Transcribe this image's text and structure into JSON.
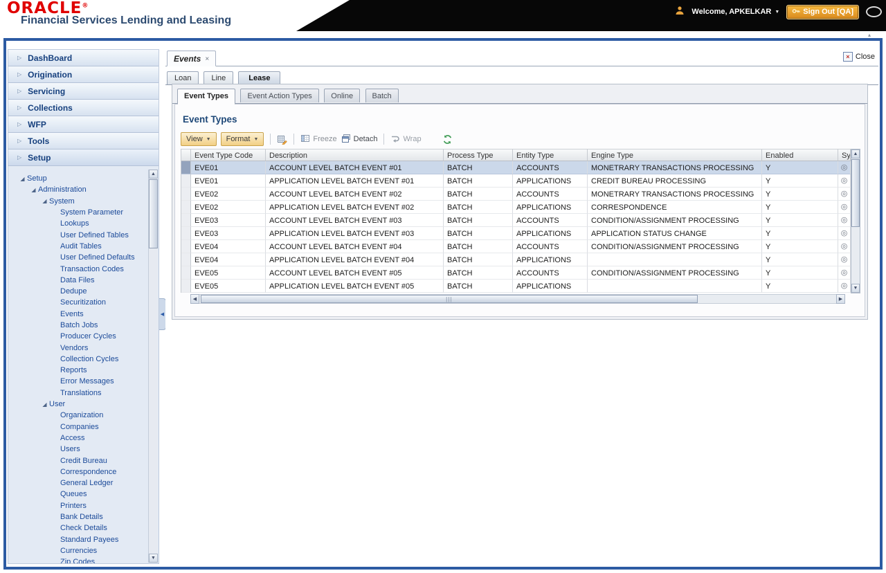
{
  "header": {
    "logo": "ORACLE",
    "registered_mark": "®",
    "subtitle": "Financial Services Lending and Leasing",
    "welcome_label": "Welcome, APKELKAR",
    "sign_out_label": "Sign Out [QA]"
  },
  "colors": {
    "oracle_red": "#e00000",
    "subtitle_blue": "#2c4a70",
    "frame_blue": "#2d5ba3",
    "toolbar_amber": "#f2cf85",
    "selected_row": "#cbd8ea"
  },
  "icons": {
    "accordion_arrow": "▷",
    "caret_down": "▼",
    "close_x": "×",
    "radio": "◎",
    "scroll_up": "▲",
    "scroll_down": "▼",
    "scroll_left": "◀",
    "scroll_right": "▶",
    "collapse_left": "◀",
    "grip": "|||",
    "mini_collapse": "▴"
  },
  "sidebar": {
    "accordion": [
      {
        "label": "DashBoard",
        "cls": ""
      },
      {
        "label": "Origination",
        "cls": ""
      },
      {
        "label": "Servicing",
        "cls": ""
      },
      {
        "label": "Collections",
        "cls": ""
      },
      {
        "label": "WFP",
        "cls": ""
      },
      {
        "label": "Tools",
        "cls": ""
      },
      {
        "label": "Setup",
        "cls": "active"
      }
    ],
    "tree": [
      {
        "label": "Setup",
        "level": 0,
        "twisty": "◢"
      },
      {
        "label": "Administration",
        "level": 1,
        "twisty": "◢"
      },
      {
        "label": "System",
        "level": 2,
        "twisty": "◢"
      },
      {
        "label": "System Parameter",
        "level": 3,
        "twisty": ""
      },
      {
        "label": "Lookups",
        "level": 3,
        "twisty": ""
      },
      {
        "label": "User Defined Tables",
        "level": 3,
        "twisty": ""
      },
      {
        "label": "Audit Tables",
        "level": 3,
        "twisty": ""
      },
      {
        "label": "User Defined Defaults",
        "level": 3,
        "twisty": ""
      },
      {
        "label": "Transaction Codes",
        "level": 3,
        "twisty": ""
      },
      {
        "label": "Data Files",
        "level": 3,
        "twisty": ""
      },
      {
        "label": "Dedupe",
        "level": 3,
        "twisty": ""
      },
      {
        "label": "Securitization",
        "level": 3,
        "twisty": ""
      },
      {
        "label": "Events",
        "level": 3,
        "twisty": ""
      },
      {
        "label": "Batch Jobs",
        "level": 3,
        "twisty": ""
      },
      {
        "label": "Producer Cycles",
        "level": 3,
        "twisty": ""
      },
      {
        "label": "Vendors",
        "level": 3,
        "twisty": ""
      },
      {
        "label": "Collection Cycles",
        "level": 3,
        "twisty": ""
      },
      {
        "label": "Reports",
        "level": 3,
        "twisty": ""
      },
      {
        "label": "Error Messages",
        "level": 3,
        "twisty": ""
      },
      {
        "label": "Translations",
        "level": 3,
        "twisty": ""
      },
      {
        "label": "User",
        "level": 2,
        "twisty": "◢"
      },
      {
        "label": "Organization",
        "level": 3,
        "twisty": ""
      },
      {
        "label": "Companies",
        "level": 3,
        "twisty": ""
      },
      {
        "label": "Access",
        "level": 3,
        "twisty": ""
      },
      {
        "label": "Users",
        "level": 3,
        "twisty": ""
      },
      {
        "label": "Credit Bureau",
        "level": 3,
        "twisty": ""
      },
      {
        "label": "Correspondence",
        "level": 3,
        "twisty": ""
      },
      {
        "label": "General Ledger",
        "level": 3,
        "twisty": ""
      },
      {
        "label": "Queues",
        "level": 3,
        "twisty": ""
      },
      {
        "label": "Printers",
        "level": 3,
        "twisty": ""
      },
      {
        "label": "Bank Details",
        "level": 3,
        "twisty": ""
      },
      {
        "label": "Check Details",
        "level": 3,
        "twisty": ""
      },
      {
        "label": "Standard Payees",
        "level": 3,
        "twisty": ""
      },
      {
        "label": "Currencies",
        "level": 3,
        "twisty": ""
      },
      {
        "label": "Zip Codes",
        "level": 3,
        "twisty": ""
      }
    ]
  },
  "main": {
    "document_tab": {
      "label": "Events"
    },
    "close_button": {
      "label": "Close"
    },
    "subtabs": [
      {
        "label": "Loan"
      },
      {
        "label": "Line"
      },
      {
        "label": "Lease"
      }
    ],
    "inner_tabs": [
      {
        "label": "Event Types"
      },
      {
        "label": "Event Action Types"
      },
      {
        "label": "Online"
      },
      {
        "label": "Batch"
      }
    ],
    "section_title": "Event Types",
    "toolbar": {
      "view_label": "View",
      "format_label": "Format",
      "freeze_label": "Freeze",
      "detach_label": "Detach",
      "wrap_label": "Wrap"
    },
    "table": {
      "columns": [
        "Event Type Code",
        "Description",
        "Process Type",
        "Entity Type",
        "Engine Type",
        "Enabled",
        "Sys"
      ],
      "rows": [
        {
          "code": "EVE01",
          "description": "ACCOUNT LEVEL BATCH EVENT #01",
          "process": "BATCH",
          "entity": "ACCOUNTS",
          "engine": "MONETRARY TRANSACTIONS PROCESSING",
          "enabled": "Y",
          "selected": "selected"
        },
        {
          "code": "EVE01",
          "description": "APPLICATION LEVEL BATCH EVENT #01",
          "process": "BATCH",
          "entity": "APPLICATIONS",
          "engine": "CREDIT BUREAU PROCESSING",
          "enabled": "Y",
          "selected": ""
        },
        {
          "code": "EVE02",
          "description": "ACCOUNT LEVEL BATCH EVENT #02",
          "process": "BATCH",
          "entity": "ACCOUNTS",
          "engine": "MONETRARY TRANSACTIONS PROCESSING",
          "enabled": "Y",
          "selected": ""
        },
        {
          "code": "EVE02",
          "description": "APPLICATION LEVEL BATCH EVENT #02",
          "process": "BATCH",
          "entity": "APPLICATIONS",
          "engine": "CORRESPONDENCE",
          "enabled": "Y",
          "selected": ""
        },
        {
          "code": "EVE03",
          "description": "ACCOUNT LEVEL BATCH EVENT #03",
          "process": "BATCH",
          "entity": "ACCOUNTS",
          "engine": "CONDITION/ASSIGNMENT PROCESSING",
          "enabled": "Y",
          "selected": ""
        },
        {
          "code": "EVE03",
          "description": "APPLICATION LEVEL BATCH EVENT #03",
          "process": "BATCH",
          "entity": "APPLICATIONS",
          "engine": "APPLICATION STATUS CHANGE",
          "enabled": "Y",
          "selected": ""
        },
        {
          "code": "EVE04",
          "description": "ACCOUNT LEVEL BATCH EVENT #04",
          "process": "BATCH",
          "entity": "ACCOUNTS",
          "engine": "CONDITION/ASSIGNMENT PROCESSING",
          "enabled": "Y",
          "selected": ""
        },
        {
          "code": "EVE04",
          "description": "APPLICATION LEVEL BATCH EVENT #04",
          "process": "BATCH",
          "entity": "APPLICATIONS",
          "engine": "",
          "enabled": "Y",
          "selected": ""
        },
        {
          "code": "EVE05",
          "description": "ACCOUNT LEVEL BATCH EVENT #05",
          "process": "BATCH",
          "entity": "ACCOUNTS",
          "engine": "CONDITION/ASSIGNMENT PROCESSING",
          "enabled": "Y",
          "selected": ""
        },
        {
          "code": "EVE05",
          "description": "APPLICATION LEVEL BATCH EVENT #05",
          "process": "BATCH",
          "entity": "APPLICATIONS",
          "engine": "",
          "enabled": "Y",
          "selected": ""
        }
      ]
    }
  }
}
